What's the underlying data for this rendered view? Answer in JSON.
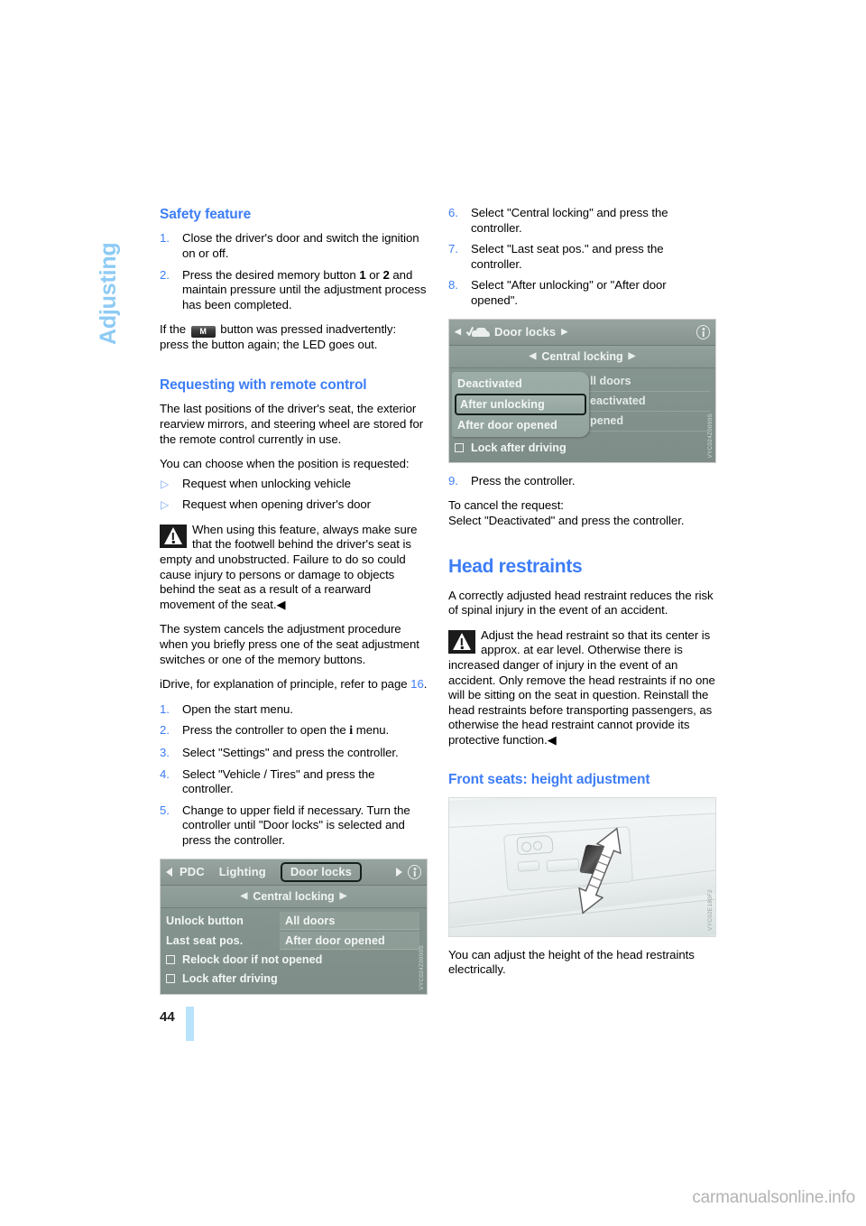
{
  "chapter_tab": "Adjusting",
  "page_number": "44",
  "watermark": "carmanualsonline.info",
  "left_column": {
    "safety_feature": {
      "heading": "Safety feature",
      "steps": [
        {
          "num": "1.",
          "text": "Close the driver's door and switch the ignition on or off."
        },
        {
          "num": "2.",
          "text": "Press the desired memory button 1 or 2 and maintain pressure until the adjustment process has been completed."
        }
      ],
      "note_before": "If the",
      "note_button": "M",
      "note_after": "button was pressed inadvertently: press the button again; the LED goes out."
    },
    "remote_control": {
      "heading": "Requesting with remote control",
      "intro": "The last positions of the driver's seat, the exterior rearview mirrors, and steering wheel are stored for the remote control currently in use.",
      "choose_lead": "You can choose when the position is requested:",
      "bullets": [
        "Request when unlocking vehicle",
        "Request when opening driver's door"
      ],
      "warning": "When using this feature, always make sure that the footwell behind the driver's seat is empty and unobstructed. Failure to do so could cause injury to persons or damage to objects behind the seat as a result of a rearward movement of the seat.",
      "warning_end": "◀",
      "cancel_note": "The system cancels the adjustment procedure when you briefly press one of the seat adjustment switches or one of the memory buttons.",
      "idrive_ref_before": "iDrive, for explanation of principle, refer to page",
      "idrive_ref_page": "16",
      "idrive_ref_after": ".",
      "steps": [
        {
          "num": "1.",
          "text": "Open the start menu."
        },
        {
          "num": "2.",
          "text_before": "Press the controller to open the",
          "icon": "i",
          "text_after": "menu."
        },
        {
          "num": "3.",
          "text": "Select \"Settings\" and press the controller."
        },
        {
          "num": "4.",
          "text": "Select \"Vehicle / Tires\" and press the controller."
        },
        {
          "num": "5.",
          "text": "Change to upper field if necessary. Turn the controller until \"Door locks\" is selected and press the controller."
        }
      ]
    },
    "idrive_screen_1": {
      "tabs": [
        "PDC",
        "Lighting"
      ],
      "selected_tab": "Door locks",
      "subtitle": "Central locking",
      "rows": [
        {
          "label": "Unlock button",
          "value": "All doors"
        },
        {
          "label": "Last seat pos.",
          "value": "After door opened"
        }
      ],
      "checkboxes": [
        "Relock door if not opened",
        "Lock after driving"
      ],
      "image_code": "VYC024Z0000S"
    }
  },
  "right_column": {
    "steps": [
      {
        "num": "6.",
        "text": "Select \"Central locking\" and press the controller."
      },
      {
        "num": "7.",
        "text": "Select \"Last seat pos.\" and press the controller."
      },
      {
        "num": "8.",
        "text": "Select \"After unlocking\" or \"After door opened\"."
      }
    ],
    "idrive_screen_2": {
      "title": "Door locks",
      "subtitle": "Central locking",
      "options": [
        "Deactivated",
        "After unlocking",
        "After door opened"
      ],
      "selected_option": "After unlocking",
      "background_values": [
        "ll doors",
        "eactivated",
        "pened"
      ],
      "checkbox": "Lock after driving",
      "image_code": "VYC024Z0000S"
    },
    "step9": {
      "num": "9.",
      "text": "Press the controller."
    },
    "cancel_lines": [
      "To cancel the request:",
      "Select \"Deactivated\" and press the controller."
    ],
    "head_restraints": {
      "heading": "Head restraints",
      "intro": "A correctly adjusted head restraint reduces the risk of spinal injury in the event of an accident.",
      "warning": "Adjust the head restraint so that its center is approx. at ear level. Otherwise there is increased danger of injury in the event of an accident. Only remove the head restraints if no one will be sitting on the seat in question. Reinstall the head restraints before transporting passengers, as otherwise the head restraint cannot provide its protective function.",
      "warning_end": "◀"
    },
    "front_seats": {
      "heading": "Front seats: height adjustment",
      "caption": "You can adjust the height of the head restraints electrically.",
      "image_code": "VYC02E180F2"
    }
  }
}
